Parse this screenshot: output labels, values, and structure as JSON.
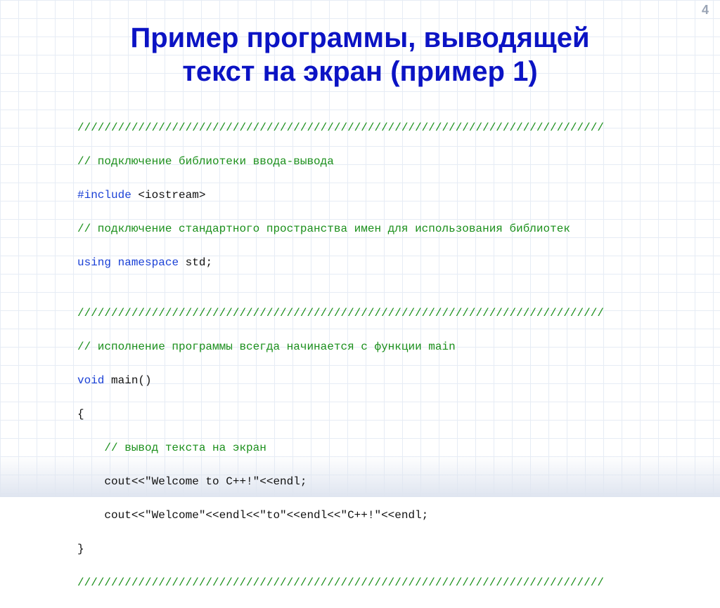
{
  "page_number": "4",
  "title_line1": "Пример программы, выводящей",
  "title_line2": "текст на экран (пример 1)",
  "code": {
    "l01": "//////////////////////////////////////////////////////////////////////////////",
    "l02": "// подключение библиотеки ввода-вывода",
    "l03a": "#include",
    "l03b": " <iostream>",
    "l04": "// подключение стандартного пространства имен для использования библиотек",
    "l05a": "using",
    "l05b": " ",
    "l05c": "namespace",
    "l05d": " std;",
    "l06": "",
    "l07": "//////////////////////////////////////////////////////////////////////////////",
    "l08": "// исполнение программы всегда начинается с функции main",
    "l09a": "void",
    "l09b": " main()",
    "l10": "{",
    "l11": "    // вывод текста на экран",
    "l12": "    cout<<\"Welcome to C++!\"<<endl;",
    "l13": "    cout<<\"Welcome\"<<endl<<\"to\"<<endl<<\"C++!\"<<endl;",
    "l14": "}",
    "l15": "//////////////////////////////////////////////////////////////////////////////"
  }
}
